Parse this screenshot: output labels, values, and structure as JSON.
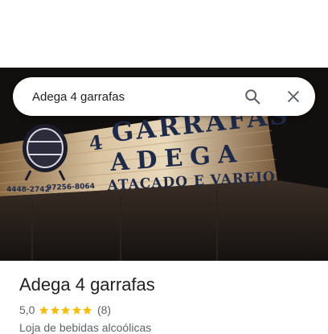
{
  "search": {
    "query": "Adega 4 garrafas"
  },
  "photo": {
    "sign_number": "4",
    "sign_line1": "GARRAFAS",
    "sign_line2": "ADEGA",
    "sign_line3": "ATACADO E VAREJO",
    "phone_left": "4448-2742",
    "phone_right": "97256-8064"
  },
  "place": {
    "name": "Adega 4 garrafas",
    "rating": "5,0",
    "rating_value": 5.0,
    "reviews": "(8)",
    "category": "Loja de bebidas alcoólicas"
  },
  "colors": {
    "star": "#fbbc04",
    "title": "#202124",
    "secondary": "#5f6368",
    "icon": "#5f6368"
  },
  "icons": [
    "search-icon",
    "close-icon",
    "star-icon",
    "barrel-logo-icon"
  ]
}
